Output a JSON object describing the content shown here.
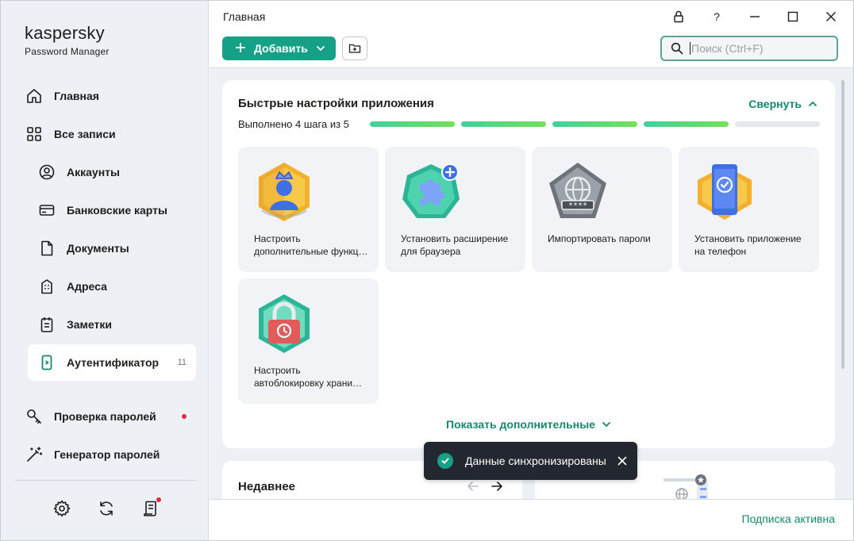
{
  "app": {
    "brand": "kaspersky",
    "product": "Password Manager",
    "window_title": "Главная"
  },
  "sidebar": {
    "items": [
      {
        "label": "Главная",
        "icon": "home-icon"
      },
      {
        "label": "Все записи",
        "icon": "grid-icon"
      },
      {
        "label": "Аккаунты",
        "icon": "user-circle-icon"
      },
      {
        "label": "Банковские карты",
        "icon": "credit-card-icon"
      },
      {
        "label": "Документы",
        "icon": "document-icon"
      },
      {
        "label": "Адреса",
        "icon": "building-icon"
      },
      {
        "label": "Заметки",
        "icon": "notepad-icon"
      },
      {
        "label": "Аутентификатор",
        "icon": "authenticator-icon",
        "count": "11",
        "active": true
      },
      {
        "label": "Проверка паролей",
        "icon": "key-check-icon",
        "alert": true
      },
      {
        "label": "Генератор паролей",
        "icon": "magic-wand-icon"
      }
    ],
    "tools": [
      "settings-gear-icon",
      "sync-icon",
      "report-icon"
    ]
  },
  "toolbar": {
    "add_label": "Добавить",
    "search_placeholder": "Поиск (Ctrl+F)"
  },
  "window_controls": {
    "help": "?"
  },
  "quick_setup": {
    "title": "Быстрые настройки приложения",
    "collapse_label": "Свернуть",
    "progress_text": "Выполнено 4 шага из 5",
    "steps_done": 4,
    "steps_total": 5,
    "tiles": [
      {
        "line1": "Настроить",
        "line2": "дополнительные функц…",
        "icon": "crown-user-icon"
      },
      {
        "line1": "Установить расширение",
        "line2": "для браузера",
        "icon": "puzzle-extension-icon"
      },
      {
        "line1": "Импортировать пароли",
        "line2": "",
        "icon": "import-globe-icon"
      },
      {
        "line1": "Установить приложение",
        "line2": "на телефон",
        "icon": "phone-check-icon"
      },
      {
        "line1": "Настроить",
        "line2": "автоблокировку храни…",
        "icon": "lock-timer-icon"
      }
    ],
    "show_more_label": "Показать дополнительные"
  },
  "recent": {
    "title": "Недавнее"
  },
  "toast": {
    "message": "Данные синхронизированы"
  },
  "footer": {
    "subscription": "Подписка активна"
  },
  "colors": {
    "accent": "#16a086",
    "accent_text": "#16876f",
    "sidebar_bg": "#edf1f6",
    "alert": "#e3263a",
    "toast_bg": "#23272f"
  }
}
